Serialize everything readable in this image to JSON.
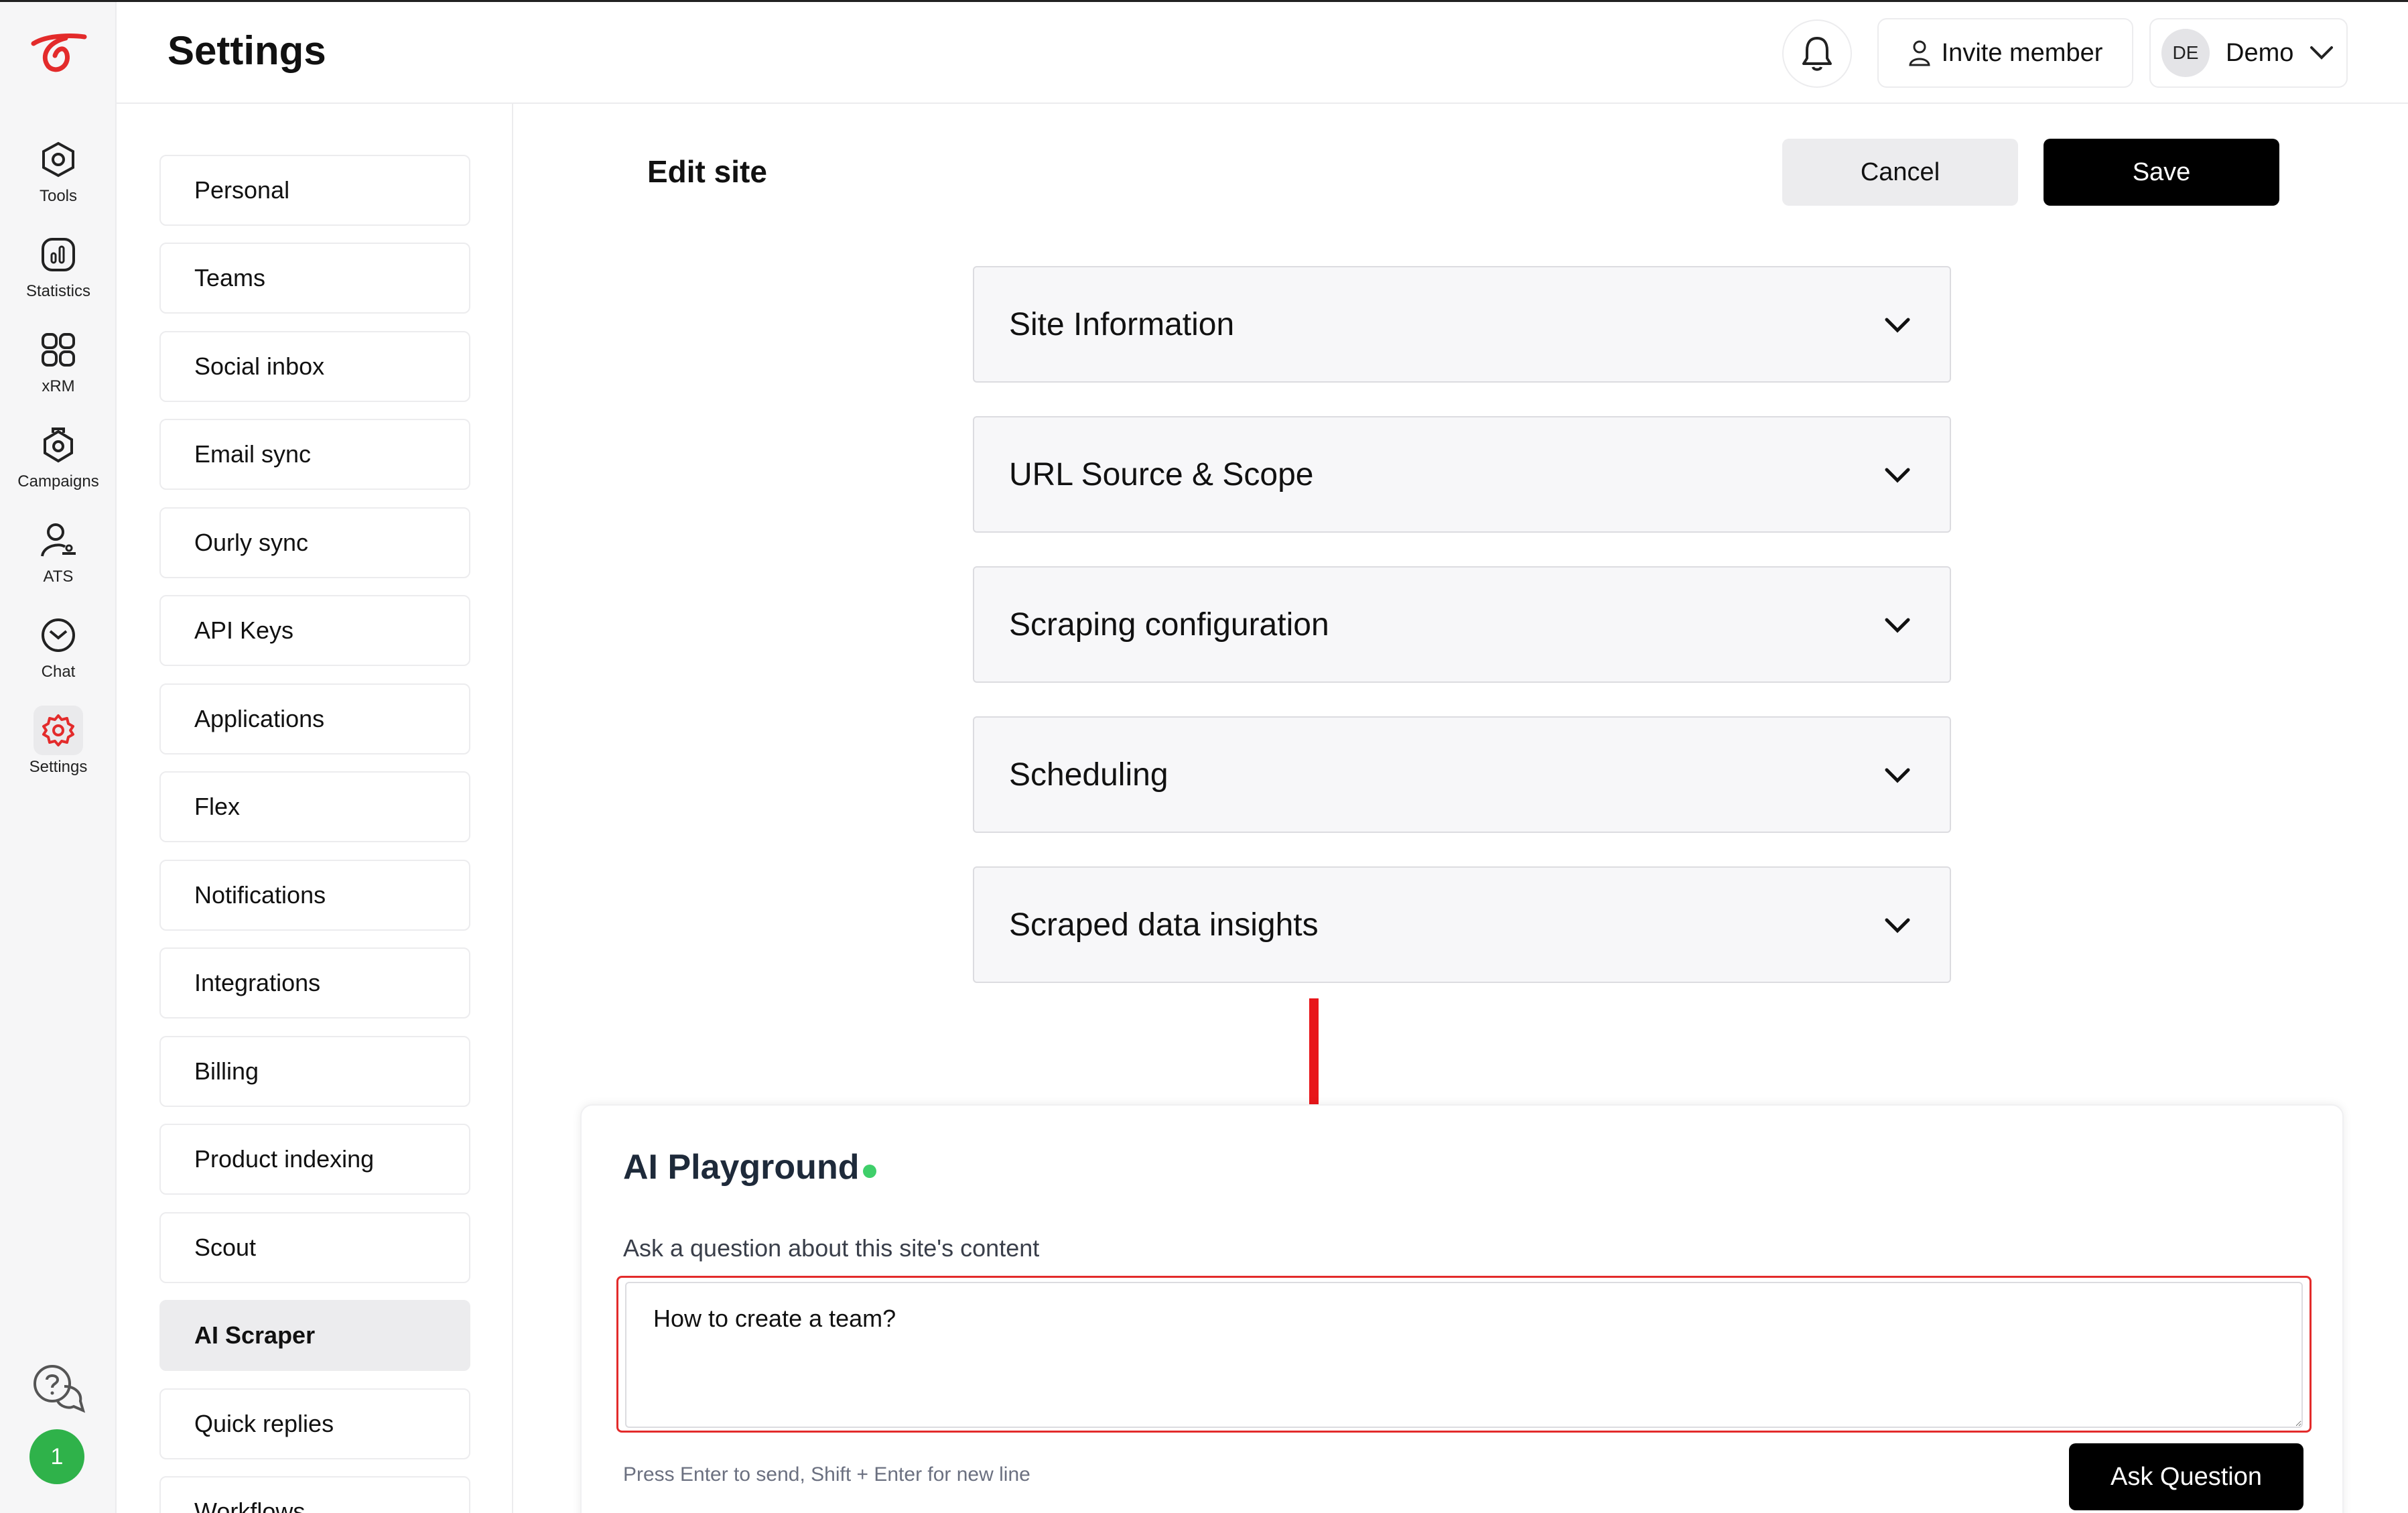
{
  "header": {
    "title": "Settings",
    "invite_label": "Invite member",
    "user_initials": "DE",
    "user_name": "Demo"
  },
  "rail": {
    "items": [
      {
        "label": "Tools",
        "icon": "tools-icon"
      },
      {
        "label": "Statistics",
        "icon": "statistics-icon"
      },
      {
        "label": "xRM",
        "icon": "grid-icon"
      },
      {
        "label": "Campaigns",
        "icon": "campaigns-icon"
      },
      {
        "label": "ATS",
        "icon": "ats-icon"
      },
      {
        "label": "Chat",
        "icon": "chat-icon"
      },
      {
        "label": "Settings",
        "icon": "gear-icon",
        "active": true
      }
    ],
    "badge_count": "1"
  },
  "settings_nav": {
    "items": [
      "Personal",
      "Teams",
      "Social inbox",
      "Email sync",
      "Ourly sync",
      "API Keys",
      "Applications",
      "Flex",
      "Notifications",
      "Integrations",
      "Billing",
      "Product indexing",
      "Scout",
      "AI Scraper",
      "Quick replies",
      "Workflows"
    ],
    "active": "AI Scraper"
  },
  "main": {
    "title": "Edit site",
    "cancel_label": "Cancel",
    "save_label": "Save",
    "accordions": [
      "Site Information",
      "URL Source & Scope",
      "Scraping configuration",
      "Scheduling",
      "Scraped data insights"
    ]
  },
  "playground": {
    "title": "AI Playground",
    "label": "Ask a question about this site's content",
    "input_value": "How to create a team?",
    "hint": "Press Enter to send, Shift + Enter for new line",
    "ask_label": "Ask Question"
  },
  "colors": {
    "accent_red": "#e32b2b",
    "status_green": "#3fcf6a",
    "badge_green": "#2fb24a",
    "primary_button": "#000000"
  }
}
